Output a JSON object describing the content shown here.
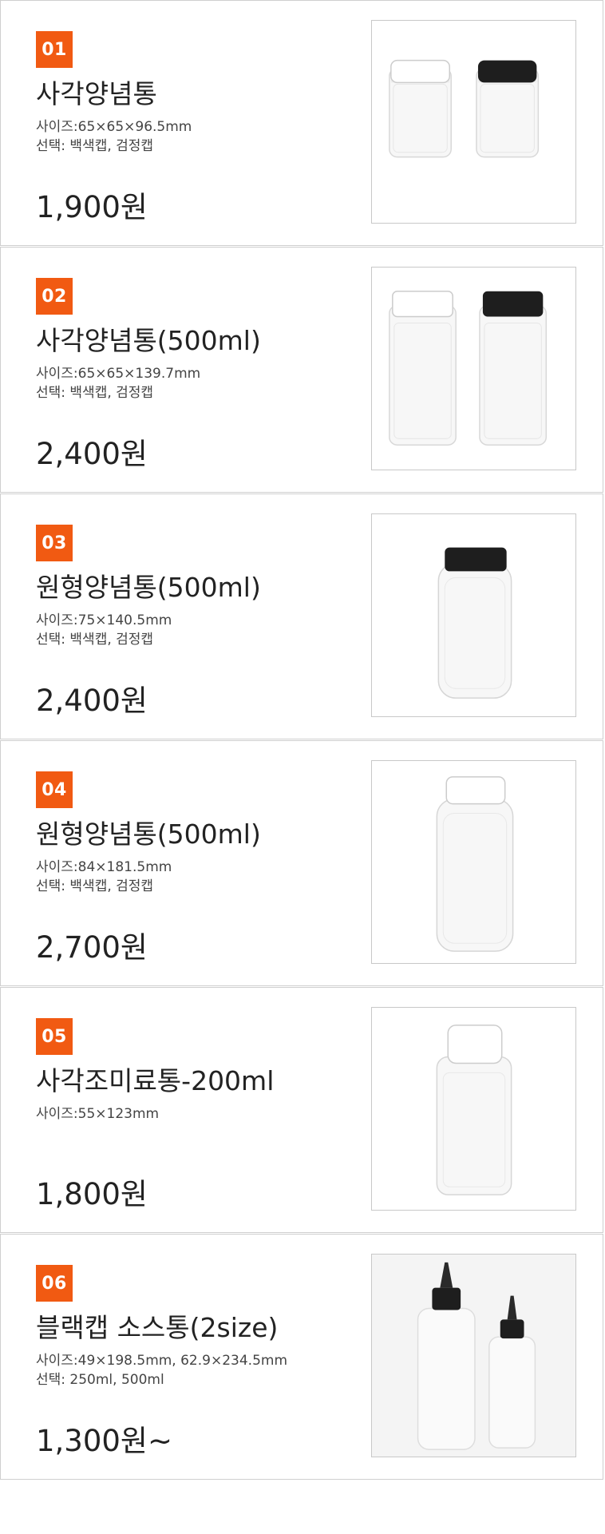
{
  "products": [
    {
      "number": "01",
      "title": "사각양념통",
      "specs": [
        "사이즈:65×65×96.5mm",
        "선택: 백색캡, 검정캡"
      ],
      "price": "1,900원",
      "image": "square-jar-short-white-black-caps"
    },
    {
      "number": "02",
      "title": "사각양념통(500ml)",
      "specs": [
        "사이즈:65×65×139.7mm",
        "선택: 백색캡, 검정캡"
      ],
      "price": "2,400원",
      "image": "square-jar-tall-white-black-caps"
    },
    {
      "number": "03",
      "title": "원형양념통(500ml)",
      "specs": [
        "사이즈:75×140.5mm",
        "선택: 백색캡, 검정캡"
      ],
      "price": "2,400원",
      "image": "round-jar-black-cap"
    },
    {
      "number": "04",
      "title": "원형양념통(500ml)",
      "specs": [
        "사이즈:84×181.5mm",
        "선택: 백색캡, 검정캡"
      ],
      "price": "2,700원",
      "image": "round-jar-white-cap"
    },
    {
      "number": "05",
      "title": "사각조미료통-200ml",
      "specs": [
        "사이즈:55×123mm"
      ],
      "price": "1,800원",
      "image": "square-seasoning-jar-white-cap"
    },
    {
      "number": "06",
      "title": "블랙캡 소스통(2size)",
      "specs": [
        "사이즈:49×198.5mm, 62.9×234.5mm",
        "선택: 250ml, 500ml"
      ],
      "price": "1,300원~",
      "image": "squeeze-bottles-black-nozzle"
    }
  ],
  "colors": {
    "badge": "#f15a12",
    "border": "#cfcfcf",
    "text": "#222222"
  }
}
